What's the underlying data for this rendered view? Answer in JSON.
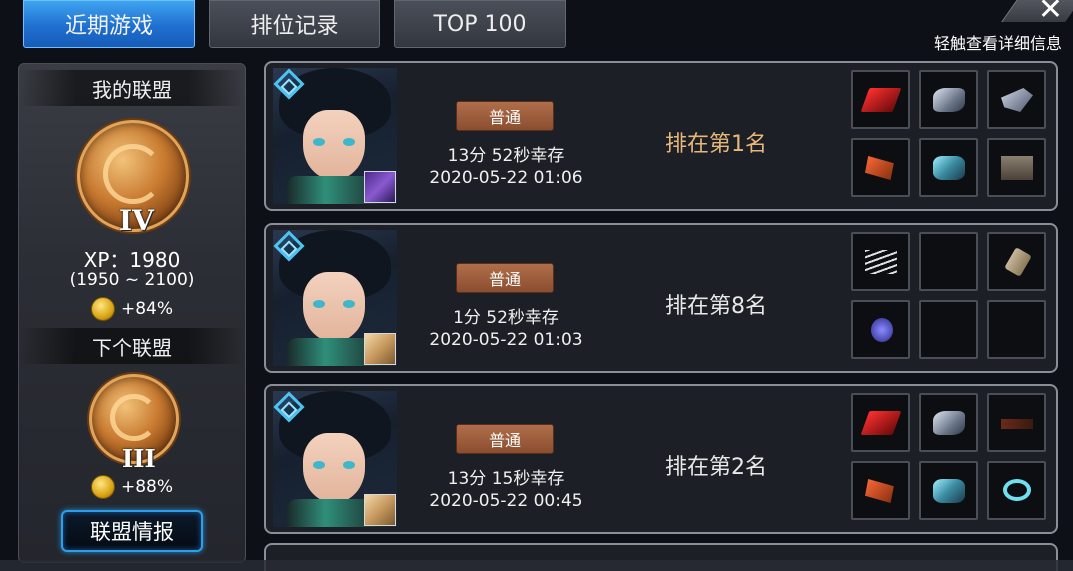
{
  "tabs": [
    {
      "label": "近期游戏",
      "active": true
    },
    {
      "label": "排位记录",
      "active": false
    },
    {
      "label": "TOP 100",
      "active": false
    }
  ],
  "hint": "轻触查看详细信息",
  "league_panel": {
    "my_league_title": "我的联盟",
    "current_rank_numeral": "IV",
    "xp": "XP：1980",
    "xp_range": "(1950 ~ 2100)",
    "current_bonus": "+84%",
    "next_league_title": "下个联盟",
    "next_rank_numeral": "III",
    "next_bonus": "+88%",
    "info_button": "联盟情报"
  },
  "games": [
    {
      "mode": "普通",
      "survival": "13分 52秒幸存",
      "date": "2020-05-22 01:06",
      "rank": "排在第1名",
      "rank_color": "#e6b87a",
      "character_badge": "purple",
      "items": [
        "red-blade-icon",
        "steel-armor-icon",
        "gun-icon",
        "claw-icon",
        "teal-gear-icon",
        "crate-icon"
      ]
    },
    {
      "mode": "普通",
      "survival": "1分 52秒幸存",
      "date": "2020-05-22 01:03",
      "rank": "排在第8名",
      "rank_color": "#e8e8e8",
      "character_badge": "tan",
      "items": [
        "blades-icon",
        "",
        "can-icon",
        "gem-icon",
        "",
        ""
      ]
    },
    {
      "mode": "普通",
      "survival": "13分 15秒幸存",
      "date": "2020-05-22 00:45",
      "rank": "排在第2名",
      "rank_color": "#e8e8e8",
      "character_badge": "tan",
      "items": [
        "red-blade-icon",
        "steel-armor-icon",
        "rifle-icon",
        "claw-icon",
        "teal-gear-icon",
        "ring-icon"
      ]
    }
  ]
}
